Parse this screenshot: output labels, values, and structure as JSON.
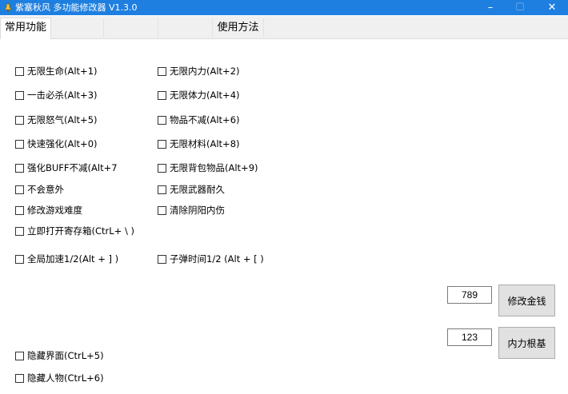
{
  "window": {
    "title": "紫塞秋风 多功能修改器  V1.3.0",
    "icon": "app-icon",
    "controls": {
      "minimize": "–",
      "maximize": "☐",
      "close": "✕"
    }
  },
  "tabs": [
    {
      "label": "常用功能",
      "active": true
    },
    {
      "label": "",
      "active": false
    },
    {
      "label": "",
      "active": false
    },
    {
      "label": "",
      "active": false
    },
    {
      "label": "使用方法",
      "active": false
    }
  ],
  "options": {
    "infinite_hp": "无限生命(Alt+1)",
    "infinite_mp": "无限内力(Alt+2)",
    "one_hit_kill": "一击必杀(Alt+3)",
    "infinite_stamina": "无限体力(Alt+4)",
    "infinite_rage": "无限怒气(Alt+5)",
    "items_no_decrease": "物品不减(Alt+6)",
    "fast_enhance": "快速强化(Alt+0)",
    "infinite_materials": "无限材料(Alt+8)",
    "buff_no_decrease": "强化BUFF不减(Alt+7",
    "infinite_bag_items": "无限背包物品(Alt+9)",
    "no_accidents": "不会意外",
    "infinite_weapon_durability": "无限武器耐久",
    "modify_difficulty": "修改游戏难度",
    "clear_yinyang_injury": "清除阴阳内伤",
    "open_storage": "立即打开寄存箱(CtrL+ \\ )",
    "global_speed": "全局加速1/2(Alt + ] )",
    "bullet_time": "子弹时间1/2 (Alt + [ )",
    "hide_ui": "隐藏界面(CtrL+5)",
    "hide_character": "隐藏人物(CtrL+6)"
  },
  "money": {
    "value": "789",
    "button": "修改金钱"
  },
  "inner_power": {
    "value": "123",
    "button": "内力根基"
  }
}
